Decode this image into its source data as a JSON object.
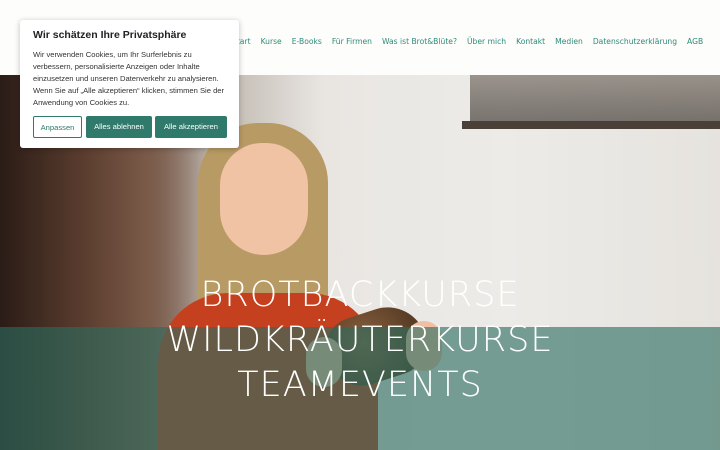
{
  "nav": {
    "items": [
      "Start",
      "Kurse",
      "E-Books",
      "Für Firmen",
      "Was ist Brot&Blüte?",
      "Über mich",
      "Kontakt",
      "Medien",
      "Datenschutzerklärung",
      "AGB"
    ]
  },
  "hero": {
    "lines": [
      "BROTBACKKURSE",
      "WILDKRÄUTERKURSE",
      "TEAMEVENTS"
    ]
  },
  "cookie": {
    "title": "Wir schätzen Ihre Privatsphäre",
    "text": "Wir verwenden Cookies, um Ihr Surferlebnis zu verbessern, personalisierte Anzeigen oder Inhalte einzusetzen und unseren Datenverkehr zu analysieren. Wenn Sie auf „Alle akzeptieren“ klicken, stimmen Sie der Anwendung von Cookies zu.",
    "btn_customize": "Anpassen",
    "btn_reject": "Alles ablehnen",
    "btn_accept": "Alle akzeptieren"
  },
  "colors": {
    "accent": "#2f7a6a",
    "nav_text": "#2f8a7a",
    "overlay": "#2b6c60"
  }
}
